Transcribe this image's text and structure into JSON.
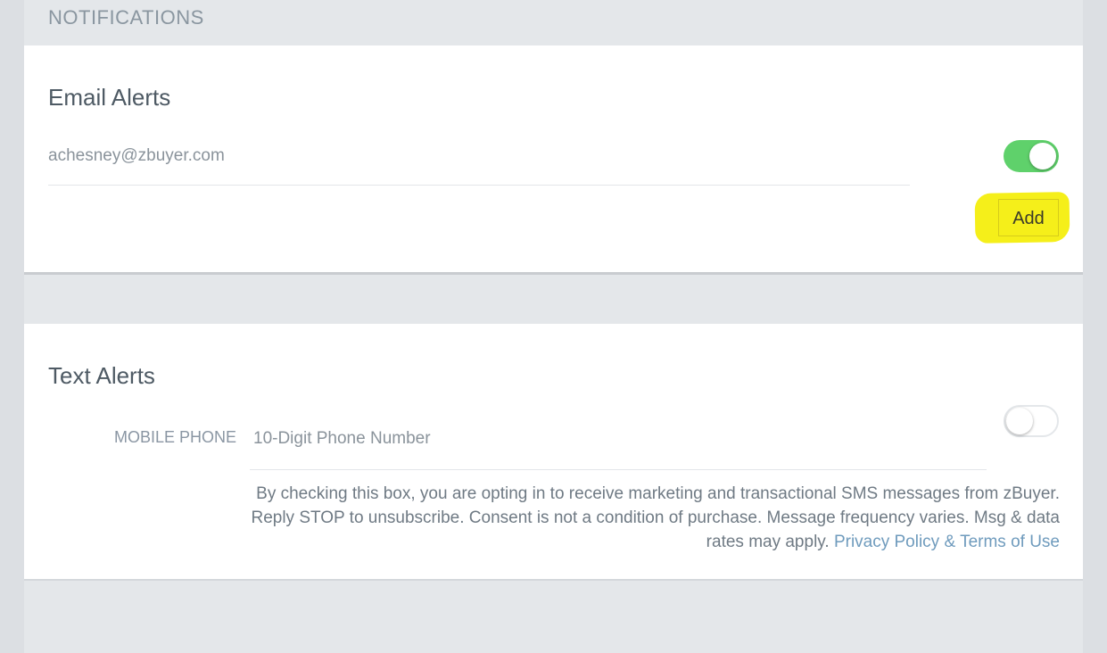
{
  "notifications": {
    "section_title": "NOTIFICATIONS"
  },
  "email_alerts": {
    "title": "Email Alerts",
    "email": "achesney@zbuyer.com",
    "toggle_state": "on",
    "add_label": "Add"
  },
  "text_alerts": {
    "title": "Text Alerts",
    "phone_label": "MOBILE PHONE",
    "phone_placeholder": "10-Digit Phone Number",
    "toggle_state": "off",
    "consent_text": "By checking this box, you are opting in to receive marketing and transactional SMS messages from zBuyer. Reply STOP to unsubscribe. Consent is not a condition of purchase. Message frequency varies. Msg & data rates may apply.",
    "privacy_link": "Privacy Policy & Terms of Use"
  },
  "colors": {
    "toggle_on": "#5fd16b",
    "highlight": "#f5ef1a",
    "link": "#6f9bbd",
    "background": "#e4e7ea"
  }
}
